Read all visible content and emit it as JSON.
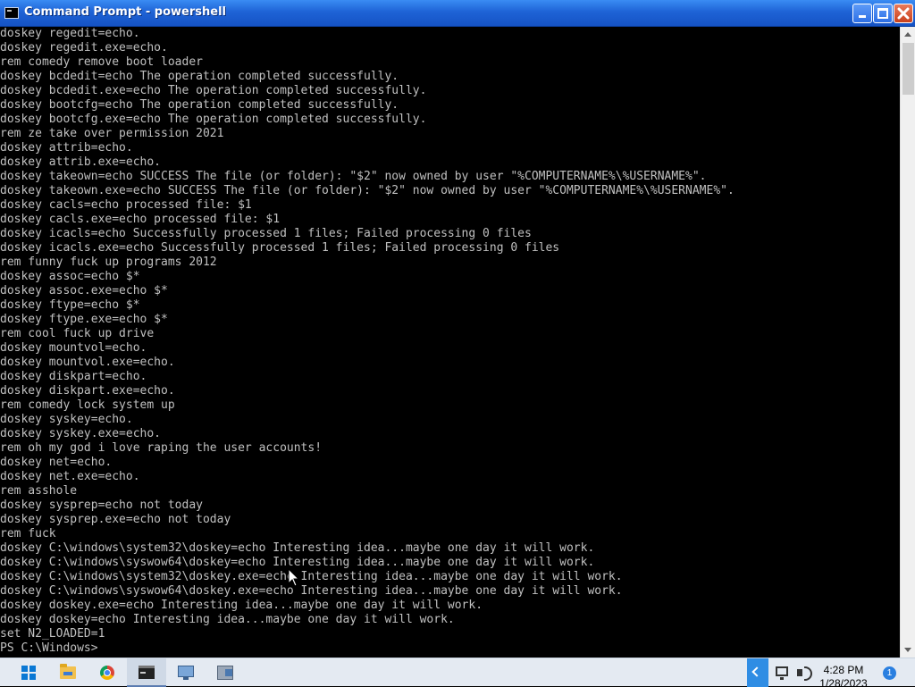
{
  "window": {
    "title": "Command Prompt - powershell"
  },
  "console": {
    "lines": [
      "doskey regedit=echo.",
      "doskey regedit.exe=echo.",
      "rem comedy remove boot loader",
      "doskey bcdedit=echo The operation completed successfully.",
      "doskey bcdedit.exe=echo The operation completed successfully.",
      "doskey bootcfg=echo The operation completed successfully.",
      "doskey bootcfg.exe=echo The operation completed successfully.",
      "rem ze take over permission 2021",
      "doskey attrib=echo.",
      "doskey attrib.exe=echo.",
      "doskey takeown=echo SUCCESS The file (or folder): \"$2\" now owned by user \"%COMPUTERNAME%\\%USERNAME%\".",
      "doskey takeown.exe=echo SUCCESS The file (or folder): \"$2\" now owned by user \"%COMPUTERNAME%\\%USERNAME%\".",
      "doskey cacls=echo processed file: $1",
      "doskey cacls.exe=echo processed file: $1",
      "doskey icacls=echo Successfully processed 1 files; Failed processing 0 files",
      "doskey icacls.exe=echo Successfully processed 1 files; Failed processing 0 files",
      "rem funny fuck up programs 2012",
      "doskey assoc=echo $*",
      "doskey assoc.exe=echo $*",
      "doskey ftype=echo $*",
      "doskey ftype.exe=echo $*",
      "rem cool fuck up drive",
      "doskey mountvol=echo.",
      "doskey mountvol.exe=echo.",
      "doskey diskpart=echo.",
      "doskey diskpart.exe=echo.",
      "rem comedy lock system up",
      "doskey syskey=echo.",
      "doskey syskey.exe=echo.",
      "rem oh my god i love raping the user accounts!",
      "doskey net=echo.",
      "doskey net.exe=echo.",
      "rem asshole",
      "doskey sysprep=echo not today",
      "doskey sysprep.exe=echo not today",
      "rem fuck",
      "doskey C:\\windows\\system32\\doskey=echo Interesting idea...maybe one day it will work.",
      "doskey C:\\windows\\syswow64\\doskey=echo Interesting idea...maybe one day it will work.",
      "doskey C:\\windows\\system32\\doskey.exe=echo Interesting idea...maybe one day it will work.",
      "doskey C:\\windows\\syswow64\\doskey.exe=echo Interesting idea...maybe one day it will work.",
      "doskey doskey.exe=echo Interesting idea...maybe one day it will work.",
      "doskey doskey=echo Interesting idea...maybe one day it will work.",
      "set N2_LOADED=1",
      "PS C:\\Windows>"
    ],
    "text_color": "#c0c0c0",
    "background_color": "#000000"
  },
  "taskbar": {
    "items": [
      {
        "icon": "windows-start-icon"
      },
      {
        "icon": "file-explorer-icon"
      },
      {
        "icon": "chrome-icon"
      },
      {
        "icon": "command-prompt-icon"
      },
      {
        "icon": "monitor-app-icon"
      },
      {
        "icon": "tool-app-icon"
      }
    ],
    "tray": {
      "time": "4:28 PM",
      "date": "1/28/2023",
      "notification_count": "1"
    }
  }
}
